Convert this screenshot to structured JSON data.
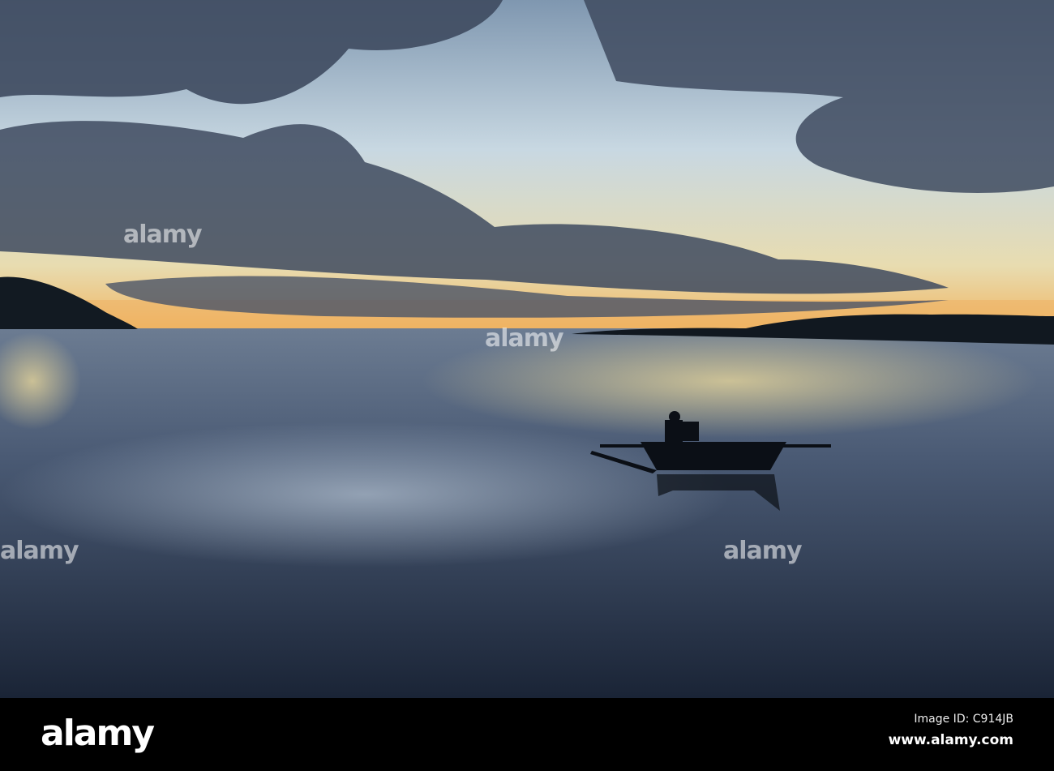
{
  "photo": {
    "subject": "Outrigger boat on calm sea at sunset",
    "colors": {
      "sky_top": "#8fa6bd",
      "sky_glow": "#f2c46a",
      "cloud": "#3f4a5e",
      "water": "#2a3649",
      "land": "#111820"
    }
  },
  "watermark": {
    "text": "alamy"
  },
  "footer": {
    "logo": "alamy",
    "image_id": "Image ID: C914JB",
    "site": "www.alamy.com"
  }
}
